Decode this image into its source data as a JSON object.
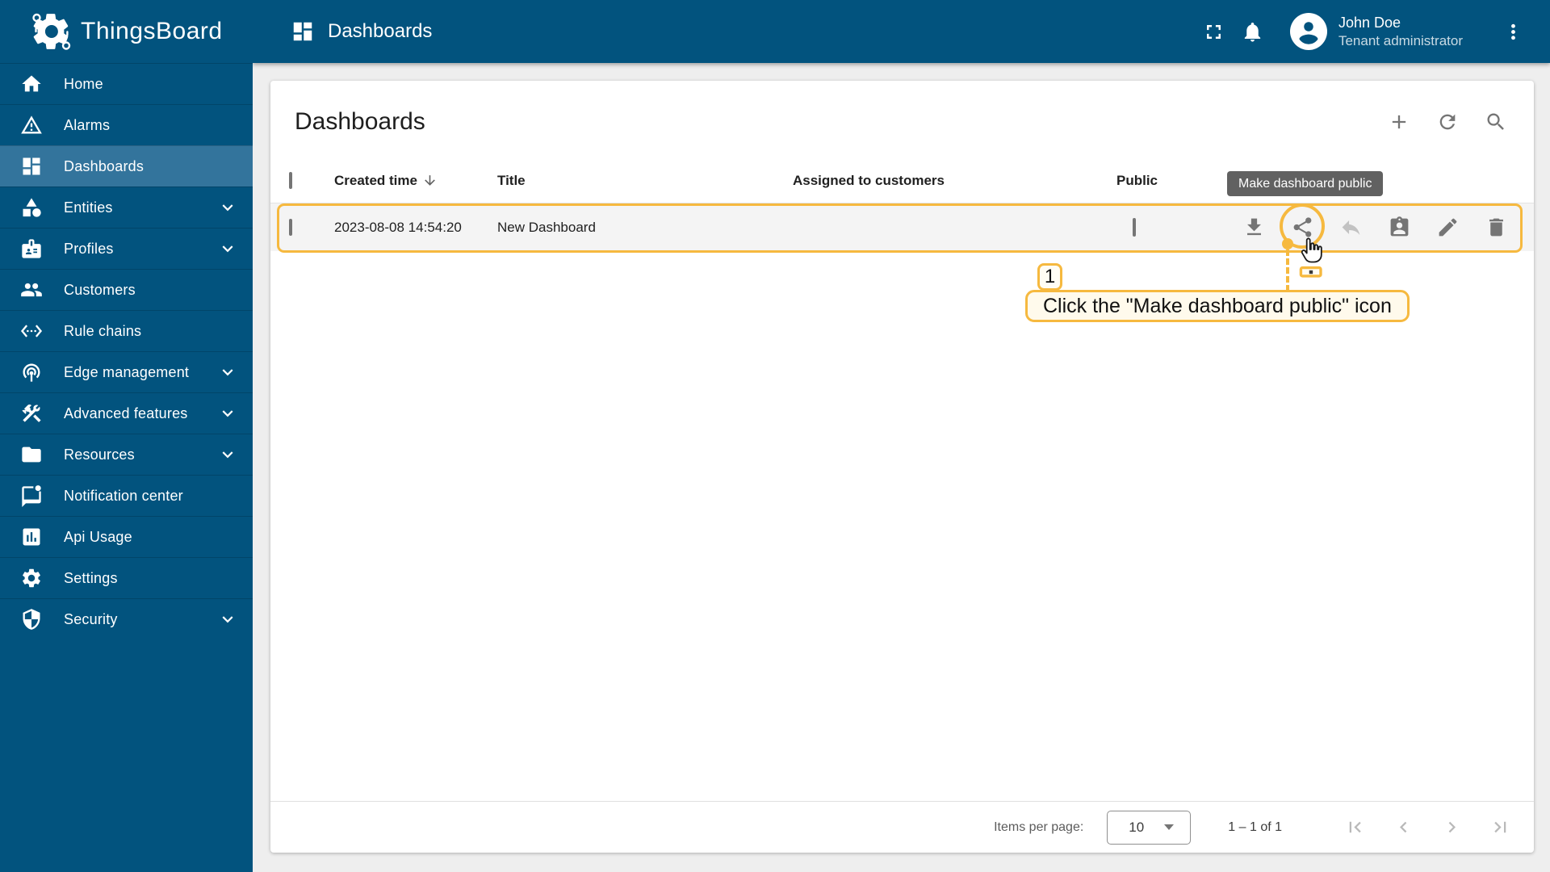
{
  "app": {
    "name": "ThingsBoard"
  },
  "topbar": {
    "title": "Dashboards",
    "user": {
      "name": "John Doe",
      "role": "Tenant administrator"
    },
    "icons": [
      "fullscreen-icon",
      "notifications-icon",
      "avatar",
      "more-vert-icon"
    ]
  },
  "sidebar": {
    "items": [
      {
        "label": "Home",
        "icon": "home-icon",
        "active": false,
        "expandable": false
      },
      {
        "label": "Alarms",
        "icon": "alarms-icon",
        "active": false,
        "expandable": false
      },
      {
        "label": "Dashboards",
        "icon": "dashboards-icon",
        "active": true,
        "expandable": false
      },
      {
        "label": "Entities",
        "icon": "entities-icon",
        "active": false,
        "expandable": true
      },
      {
        "label": "Profiles",
        "icon": "profiles-icon",
        "active": false,
        "expandable": true
      },
      {
        "label": "Customers",
        "icon": "customers-icon",
        "active": false,
        "expandable": false
      },
      {
        "label": "Rule chains",
        "icon": "rule-chains-icon",
        "active": false,
        "expandable": false
      },
      {
        "label": "Edge management",
        "icon": "edge-management-icon",
        "active": false,
        "expandable": true
      },
      {
        "label": "Advanced features",
        "icon": "advanced-features-icon",
        "active": false,
        "expandable": true
      },
      {
        "label": "Resources",
        "icon": "resources-icon",
        "active": false,
        "expandable": true
      },
      {
        "label": "Notification center",
        "icon": "notification-center-icon",
        "active": false,
        "expandable": false
      },
      {
        "label": "Api Usage",
        "icon": "api-usage-icon",
        "active": false,
        "expandable": false
      },
      {
        "label": "Settings",
        "icon": "settings-icon",
        "active": false,
        "expandable": false
      },
      {
        "label": "Security",
        "icon": "security-icon",
        "active": false,
        "expandable": true
      }
    ]
  },
  "main": {
    "card_title": "Dashboards",
    "header_action_icons": [
      "add-icon",
      "refresh-icon",
      "search-icon"
    ],
    "table": {
      "headers": {
        "created_time": "Created time",
        "title": "Title",
        "assigned_to_customers": "Assigned to customers",
        "public": "Public"
      },
      "rows": [
        {
          "created_time": "2023-08-08 14:54:20",
          "title": "New Dashboard",
          "assigned_to_customers": "",
          "public_checked": false
        }
      ],
      "row_action_icons": [
        "download-icon",
        "share-icon",
        "undo-icon",
        "assigned-customers-icon",
        "edit-icon",
        "delete-icon"
      ]
    },
    "pagination": {
      "items_per_page_label": "Items per page:",
      "page_size": "10",
      "range": "1 – 1 of 1",
      "nav_icons": [
        "first-page-icon",
        "prev-page-icon",
        "next-page-icon",
        "last-page-icon"
      ]
    }
  },
  "tooltip": {
    "text": "Make dashboard public"
  },
  "annotation": {
    "step_number": "1",
    "instruction": "Click the \"Make dashboard public\" icon"
  },
  "colors": {
    "primary": "#02537e",
    "active_item": "#33749c",
    "accent": "#f6b93f",
    "tooltip_bg": "#616161",
    "row_highlight": "#f4f4f4"
  }
}
